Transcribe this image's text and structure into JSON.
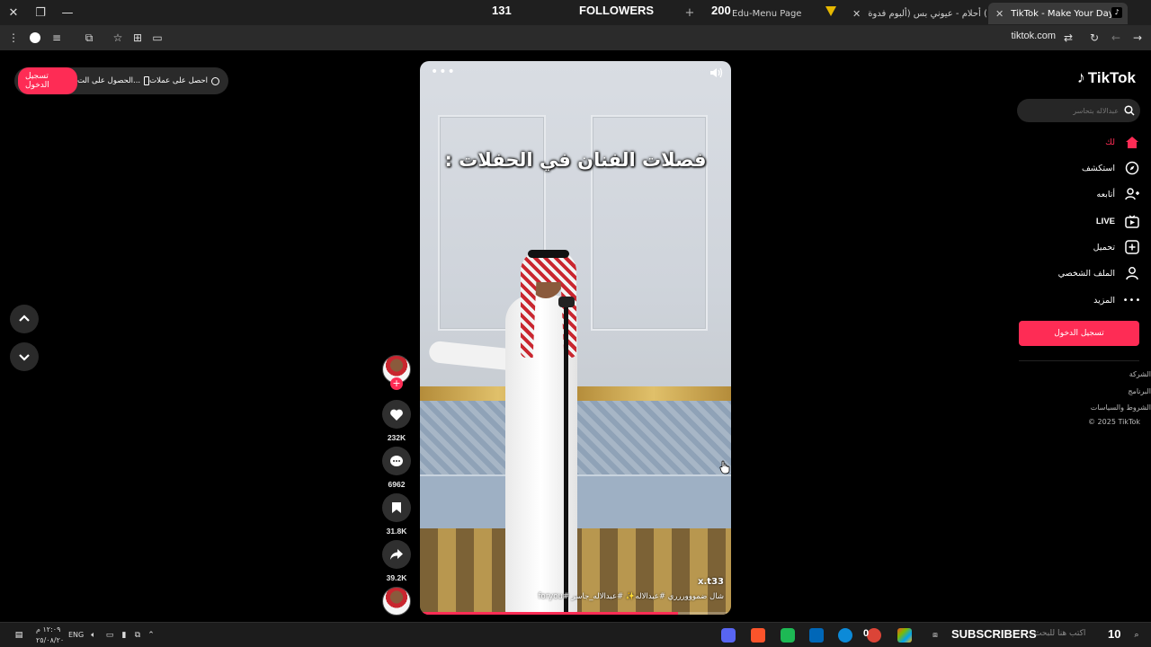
{
  "browser": {
    "tabs": [
      {
        "title": "Edu-Menu Page",
        "active": false
      },
      {
        "title": "(1) أحلام - عيوني بس (ألبوم فدوة",
        "active": false
      },
      {
        "title": "TikTok - Make Your Day",
        "active": true
      }
    ],
    "url": "tiktok.com"
  },
  "stream_overlay": {
    "followers_count": "131",
    "followers_label": "FOLLOWERS",
    "followers_goal": "200",
    "subscribers_label": "SUBSCRIBERS",
    "subscribers_count": "10"
  },
  "promo": {
    "item1": "احصل على عملات",
    "item2": "الحصول على الت...",
    "login": "تسجيل الدخول"
  },
  "video": {
    "caption": "فصلات الفنان في الحفلات :",
    "handle": "x.t33",
    "description": "شال ضموووررري #عبدالاله✨ #عبدالاله_جاسر #foryou",
    "progress": 0.83
  },
  "actions": {
    "likes": "232K",
    "comments": "6962",
    "saves": "31.8K",
    "shares": "39.2K"
  },
  "sidebar": {
    "logo": "TikTok",
    "search_placeholder": "عبدالاله بتحاسر",
    "nav": {
      "for_you": "لك",
      "explore": "استكشف",
      "following": "أتابعه",
      "live": "LIVE",
      "upload": "تحميل",
      "profile": "الملف الشخصي",
      "more": "المزيد"
    },
    "login_button": "تسجيل الدخول",
    "footer": {
      "company": "الشركة",
      "program": "البرنامج",
      "terms": "الشروط والسياسات",
      "copyright": "© 2025 TikTok"
    }
  },
  "taskbar": {
    "lang": "ENG",
    "time": "١٢:٠٩ م",
    "date": "٢٥/٠٨/٢٠",
    "search_placeholder": "اكتب هنا للبحث",
    "chrome_badge": "0"
  },
  "colors": {
    "accent": "#fe2c55",
    "background": "#000000",
    "rail_circle": "#2f2f2f"
  }
}
